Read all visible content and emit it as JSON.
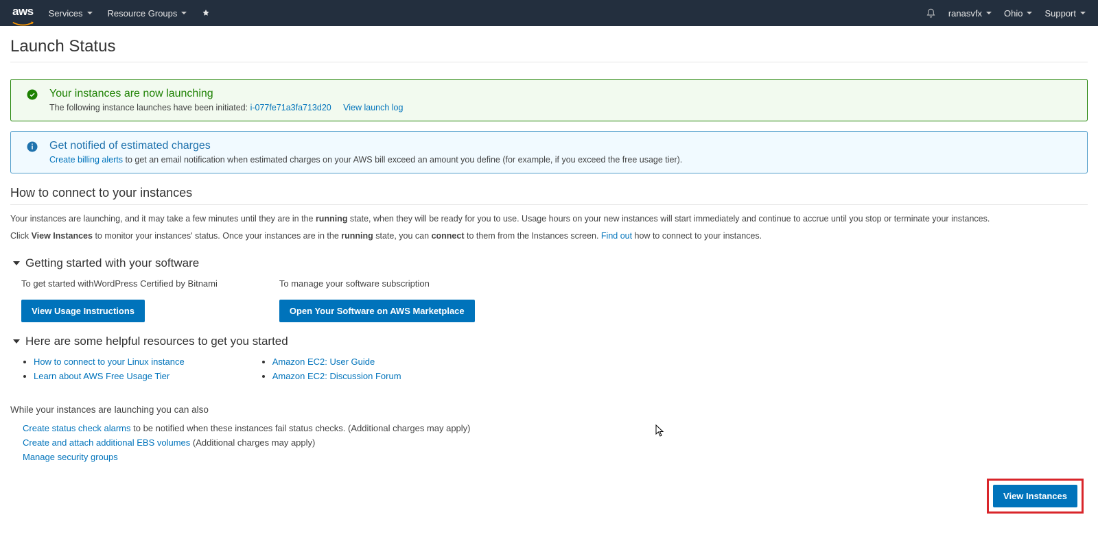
{
  "navbar": {
    "logo_text": "aws",
    "services": "Services",
    "resource_groups": "Resource Groups",
    "account": "ranasvfx",
    "region": "Ohio",
    "support": "Support"
  },
  "page": {
    "title": "Launch Status"
  },
  "alerts": {
    "success": {
      "title": "Your instances are now launching",
      "body_prefix": "The following instance launches have been initiated:",
      "instance_id": "i-077fe71a3fa713d20",
      "view_log": "View launch log"
    },
    "info": {
      "title": "Get notified of estimated charges",
      "link": "Create billing alerts",
      "body_suffix": "to get an email notification when estimated charges on your AWS bill exceed an amount you define (for example, if you exceed the free usage tier)."
    }
  },
  "connect": {
    "heading": "How to connect to your instances",
    "p1_a": "Your instances are launching, and it may take a few minutes until they are in the ",
    "p1_b": "running",
    "p1_c": " state, when they will be ready for you to use. Usage hours on your new instances will start immediately and continue to accrue until you stop or terminate your instances.",
    "p2_a": "Click ",
    "p2_b": "View Instances",
    "p2_c": " to monitor your instances' status. Once your instances are in the ",
    "p2_d": "running",
    "p2_e": " state, you can ",
    "p2_f": "connect",
    "p2_g": " to them from the Instances screen. ",
    "p2_link": "Find out",
    "p2_h": " how to connect to your instances."
  },
  "software": {
    "heading": "Getting started with your software",
    "col1_label": "To get started withWordPress Certified by Bitnami",
    "col1_button": "View Usage Instructions",
    "col2_label": "To manage your software subscription",
    "col2_button": "Open Your Software on AWS Marketplace"
  },
  "resources": {
    "heading": "Here are some helpful resources to get you started",
    "col1": [
      "How to connect to your Linux instance",
      "Learn about AWS Free Usage Tier"
    ],
    "col2": [
      "Amazon EC2: User Guide",
      "Amazon EC2: Discussion Forum"
    ]
  },
  "while": {
    "heading": "While your instances are launching you can also",
    "item1_link": "Create status check alarms",
    "item1_text": " to be notified when these instances fail status checks. (Additional charges may apply)",
    "item2_link": "Create and attach additional EBS volumes",
    "item2_text": " (Additional charges may apply)",
    "item3_link": "Manage security groups"
  },
  "footer": {
    "view_instances": "View Instances"
  }
}
